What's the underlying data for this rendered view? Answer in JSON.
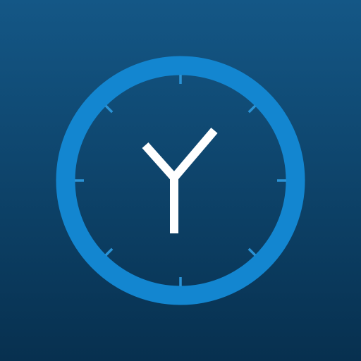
{
  "app_icon": {
    "name": "clock app icon",
    "colors": {
      "background_top": "#145786",
      "background_bottom": "#07304f",
      "ring": "#1386d0",
      "ticks": "#2a93d6",
      "hands": "#ffffff"
    },
    "icons": [
      "clock-icon"
    ]
  }
}
